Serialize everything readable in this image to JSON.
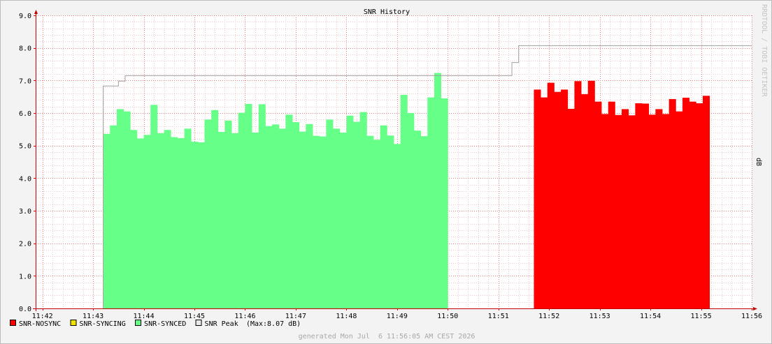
{
  "chart_data": {
    "type": "area",
    "title": "SNR History",
    "ylabel": "dB",
    "ylim": [
      0,
      9
    ],
    "y_ticks": [
      "0.0",
      "1.0",
      "2.0",
      "3.0",
      "4.0",
      "5.0",
      "6.0",
      "7.0",
      "8.0",
      "9.0"
    ],
    "x_range": [
      "11:41:52",
      "11:56:00"
    ],
    "x_ticks": [
      "11:42",
      "11:43",
      "11:44",
      "11:45",
      "11:46",
      "11:47",
      "11:48",
      "11:49",
      "11:50",
      "11:51",
      "11:52",
      "11:53",
      "11:54",
      "11:55",
      "11:56"
    ],
    "grid": true,
    "legend_placement": "bottom-left",
    "series": [
      {
        "name": "SNR-NOSYNC",
        "color": "#ff0000",
        "x_start": "11:51:42",
        "step_seconds": 8,
        "values": [
          6.72,
          6.48,
          6.93,
          6.65,
          6.72,
          6.13,
          6.98,
          6.58,
          6.99,
          6.35,
          5.97,
          6.35,
          5.94,
          6.12,
          5.93,
          6.3,
          6.29,
          5.95,
          6.12,
          5.97,
          6.43,
          6.05,
          6.47,
          6.35,
          6.3,
          6.53
        ]
      },
      {
        "name": "SNR-SYNCING",
        "color": "#f0e000",
        "values": []
      },
      {
        "name": "SNR-SYNCED",
        "color": "#66ff88",
        "x_start": "11:43:12",
        "step_seconds": 8,
        "values": [
          5.36,
          5.62,
          6.12,
          6.05,
          5.48,
          5.22,
          5.33,
          6.25,
          5.38,
          5.48,
          5.26,
          5.23,
          5.52,
          5.12,
          5.1,
          5.8,
          6.09,
          5.42,
          5.77,
          5.38,
          6.01,
          6.28,
          5.4,
          6.27,
          5.6,
          5.65,
          5.52,
          5.95,
          5.72,
          5.43,
          5.66,
          5.3,
          5.28,
          5.8,
          5.52,
          5.4,
          5.92,
          5.73,
          6.03,
          5.3,
          5.18,
          5.62,
          5.31,
          5.05,
          6.56,
          6.0,
          5.46,
          5.29,
          6.48,
          7.23,
          6.45
        ]
      },
      {
        "name": "SNR Peak",
        "color": "#a0a0a0",
        "style": "line",
        "max_label": "(Max:8.07 dB)",
        "points": [
          {
            "x": "11:43:12",
            "y": 6.83
          },
          {
            "x": "11:43:30",
            "y": 6.98
          },
          {
            "x": "11:43:38",
            "y": 7.15
          },
          {
            "x": "11:51:16",
            "y": 7.55
          },
          {
            "x": "11:51:24",
            "y": 8.07
          },
          {
            "x": "11:56:00",
            "y": 8.07
          }
        ]
      }
    ],
    "watermark": "RRDTOOL / TOBI OETIKER",
    "footer": "generated Mon Jul  6 11:56:05 AM CEST 2026"
  }
}
